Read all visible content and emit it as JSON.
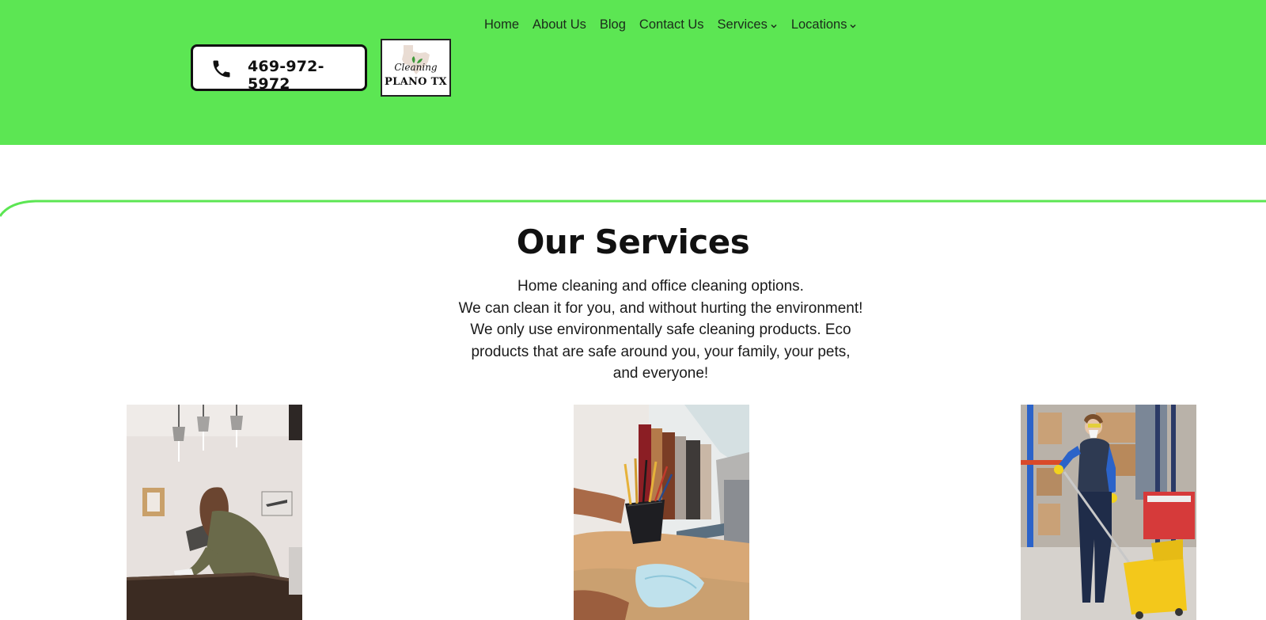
{
  "header": {
    "background_color": "#5ce653",
    "nav": {
      "items": [
        {
          "label": "Home",
          "dropdown": false
        },
        {
          "label": "About Us",
          "dropdown": false
        },
        {
          "label": "Blog",
          "dropdown": false
        },
        {
          "label": "Contact Us",
          "dropdown": false
        },
        {
          "label": "Services",
          "dropdown": true
        },
        {
          "label": "Locations",
          "dropdown": true
        }
      ]
    },
    "phone": {
      "icon": "phone-icon",
      "number": "469-972-5972"
    },
    "logo": {
      "script_text": "Cleaning",
      "city_text": "PLANO TX"
    }
  },
  "services": {
    "title": "Our Services",
    "description_lines": [
      "Home cleaning and office cleaning options.",
      "We can clean it for you, and without hurting the environment!",
      "We only use environmentally safe cleaning products. Eco",
      "products that are safe around you, your family, your pets,",
      "and everyone!"
    ],
    "photos": [
      {
        "subject": "woman-wiping-table-photo"
      },
      {
        "subject": "desk-pencil-holder-photo"
      },
      {
        "subject": "warehouse-worker-mopping-photo"
      }
    ]
  },
  "colors": {
    "accent_green": "#5ce653",
    "text_dark": "#111111"
  }
}
